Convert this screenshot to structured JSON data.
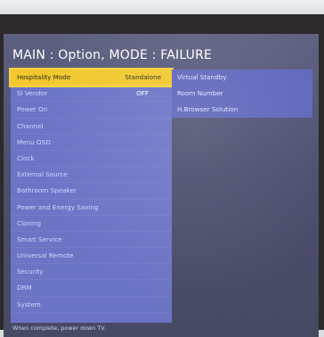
{
  "title": "MAIN : Option, MODE : FAILURE",
  "left_menu": [
    {
      "label": "Hospitality Mode",
      "value": "Standalone",
      "selected": true
    },
    {
      "label": "SI Vendor",
      "value": "OFF"
    },
    {
      "label": "Power On"
    },
    {
      "label": "Channel"
    },
    {
      "label": "Menu OSD"
    },
    {
      "label": "Clock"
    },
    {
      "label": "External Source"
    },
    {
      "label": "Bathroom Speaker"
    },
    {
      "label": "Power and Energy Saving"
    },
    {
      "label": "Cloning"
    },
    {
      "label": "Smart Service"
    },
    {
      "label": "Universal Remote"
    },
    {
      "label": "Security"
    },
    {
      "label": "DRM"
    },
    {
      "label": "System"
    }
  ],
  "right_menu": [
    {
      "label": "Virtual Standby"
    },
    {
      "label": "Room Number"
    },
    {
      "label": "H.Browser Solution"
    }
  ],
  "footer": "When complete, power down TV."
}
